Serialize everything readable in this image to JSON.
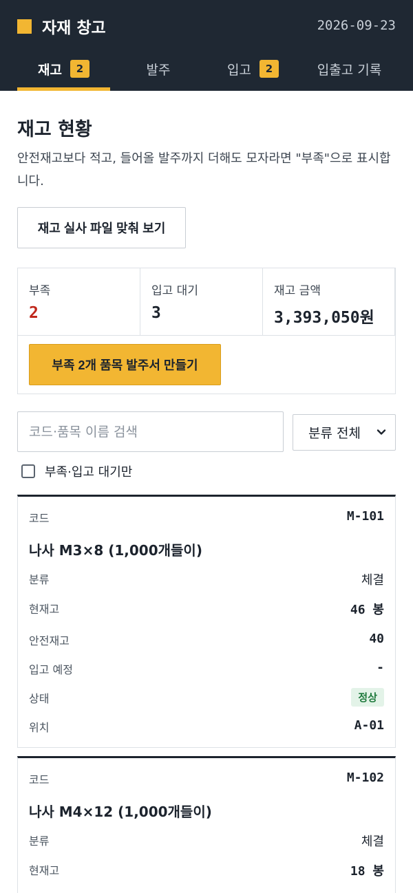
{
  "app": {
    "title": "자재 창고",
    "date": "2026-09-23",
    "brand_color": "#f2b632",
    "header_bg": "#1f2833"
  },
  "tabs": [
    {
      "label": "재고",
      "badge": "2",
      "active": true
    },
    {
      "label": "발주",
      "badge": "",
      "active": false
    },
    {
      "label": "입고",
      "badge": "2",
      "active": false
    },
    {
      "label": "입출고 기록",
      "badge": "",
      "active": false
    }
  ],
  "section": {
    "title": "재고 현황",
    "description": "안전재고보다 적고, 들어올 발주까지 더해도 모자라면 \"부족\"으로 표시합니다.",
    "reconcile_button": "재고 실사 파일 맞춰 보기"
  },
  "summary": {
    "shortage_label": "부족",
    "shortage_value": "2",
    "pending_label": "입고 대기",
    "pending_value": "3",
    "amount_label": "재고 금액",
    "amount_value": "3,393,050원",
    "order_button": "부족 2개 품목 발주서 만들기"
  },
  "filters": {
    "search_placeholder": "코드·품목 이름 검색",
    "search_value": "",
    "category_selected": "분류 전체",
    "only_shortage_label": "부족·입고 대기만",
    "only_shortage_checked": false
  },
  "labels": {
    "code": "코드",
    "category": "분류",
    "on_hand": "현재고",
    "safety_stock": "안전재고",
    "incoming": "입고 예정",
    "status": "상태",
    "location": "위치"
  },
  "items": [
    {
      "code": "M-101",
      "name": "나사 M3×8 (1,000개들이)",
      "category": "체결",
      "on_hand": "46 봉",
      "safety_stock": "40",
      "incoming": "-",
      "status": "정상",
      "location": "A-01"
    },
    {
      "code": "M-102",
      "name": "나사 M4×12 (1,000개들이)",
      "category": "체결",
      "on_hand": "18 봉"
    }
  ]
}
